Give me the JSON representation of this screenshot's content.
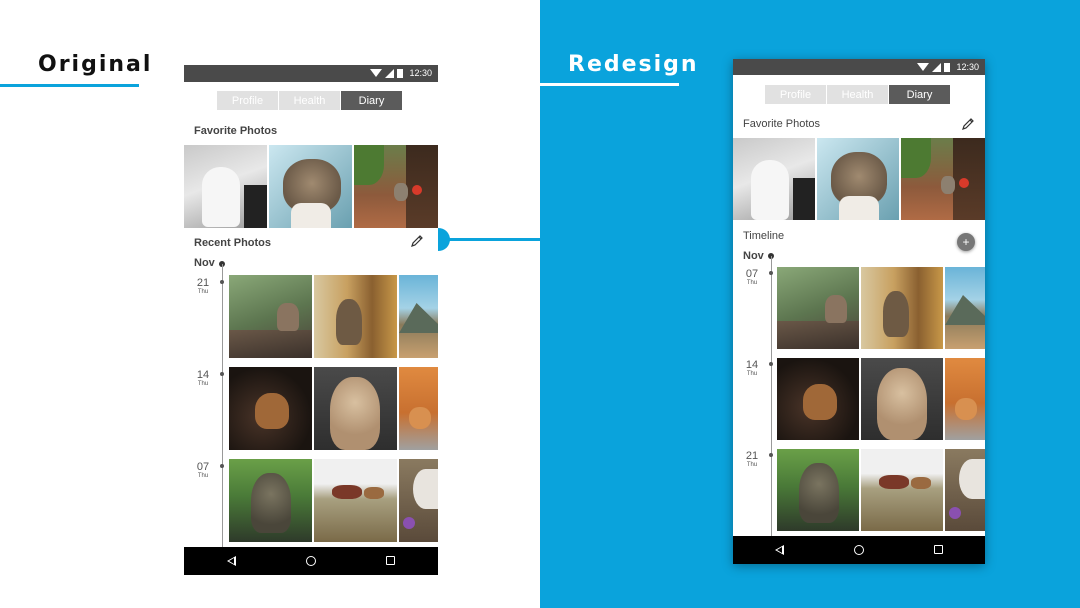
{
  "headings": {
    "original": "Original",
    "redesign": "Redesign"
  },
  "status": {
    "time": "12:30"
  },
  "tabs": [
    "Profile",
    "Health",
    "Diary"
  ],
  "active_tab": "Diary",
  "original": {
    "favorites_title": "Favorite Photos",
    "recent_title": "Recent Photos",
    "month": "Nov",
    "days": [
      {
        "num": "21",
        "wd": "Thu"
      },
      {
        "num": "14",
        "wd": "Thu"
      },
      {
        "num": "07",
        "wd": "Thu"
      }
    ]
  },
  "redesign": {
    "favorites_title": "Favorite Photos",
    "timeline_title": "Timeline",
    "add_symbol": "+",
    "month": "Nov",
    "days": [
      {
        "num": "07",
        "wd": "Thu"
      },
      {
        "num": "14",
        "wd": "Thu"
      },
      {
        "num": "21",
        "wd": "Thu"
      }
    ]
  },
  "colors": {
    "accent": "#0aa3dc",
    "tab_active": "#5b5b5b",
    "tab_inactive": "#e1e1e1"
  }
}
